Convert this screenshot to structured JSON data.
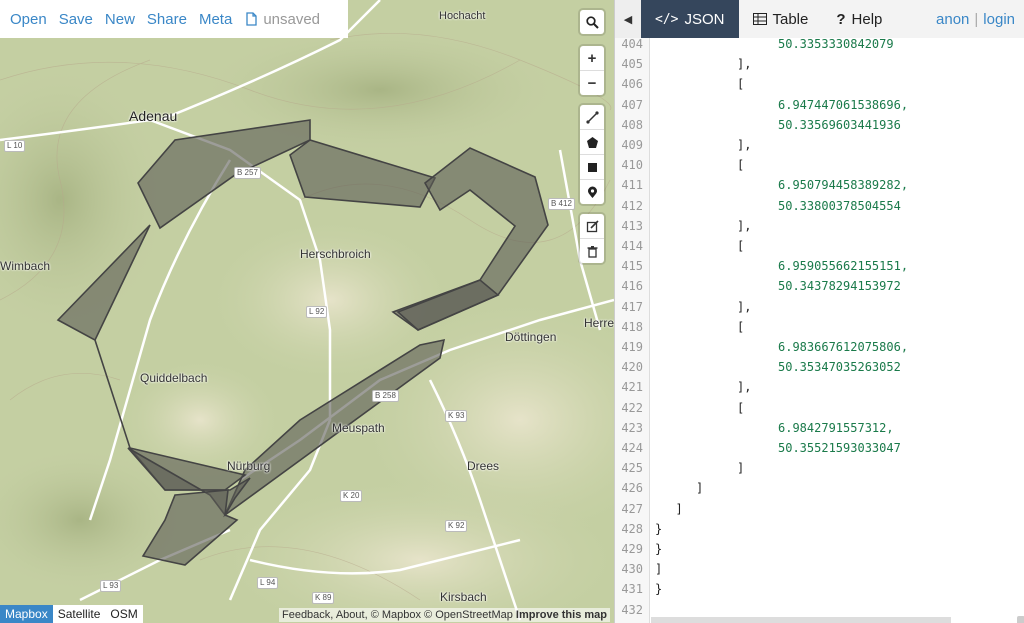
{
  "menu": {
    "items": [
      {
        "label": "Open"
      },
      {
        "label": "Save"
      },
      {
        "label": "New"
      },
      {
        "label": "Share"
      },
      {
        "label": "Meta"
      }
    ],
    "status": "unsaved"
  },
  "map": {
    "places": [
      {
        "name": "Adenau"
      },
      {
        "name": "Hochacht"
      },
      {
        "name": "Wimbach"
      },
      {
        "name": "Herschbroich"
      },
      {
        "name": "Quiddelbach"
      },
      {
        "name": "Nürburg"
      },
      {
        "name": "Meuspath"
      },
      {
        "name": "Döttingen"
      },
      {
        "name": "Drees"
      },
      {
        "name": "Kirsbach"
      },
      {
        "name": "Herre"
      }
    ],
    "roads": [
      {
        "label": "L 10"
      },
      {
        "label": "B 257"
      },
      {
        "label": "L 92"
      },
      {
        "label": "B 258"
      },
      {
        "label": "K 93"
      },
      {
        "label": "K 20"
      },
      {
        "label": "K 92"
      },
      {
        "label": "L 94"
      },
      {
        "label": "K 89"
      },
      {
        "label": "L 93"
      },
      {
        "label": "B 412"
      }
    ],
    "layers": [
      {
        "label": "Mapbox",
        "active": true
      },
      {
        "label": "Satellite",
        "active": false
      },
      {
        "label": "OSM",
        "active": false
      }
    ],
    "attribution": {
      "feedback": "Feedback",
      "about": "About",
      "copyright": "© Mapbox © OpenStreetMap",
      "improve": "Improve this map"
    }
  },
  "panel": {
    "tabs": [
      {
        "label": "JSON",
        "active": true
      },
      {
        "label": "Table",
        "active": false
      },
      {
        "label": "Help",
        "active": false
      }
    ],
    "auth": {
      "anon": "anon",
      "sep": "|",
      "login": "login"
    },
    "lines": [
      {
        "n": "404",
        "indent": "      ",
        "text": "50.3353330842079",
        "kind": "num"
      },
      {
        "n": "405",
        "indent": "    ",
        "text": "],",
        "kind": "punc"
      },
      {
        "n": "406",
        "indent": "    ",
        "text": "[",
        "kind": "punc"
      },
      {
        "n": "407",
        "indent": "      ",
        "text": "6.947447061538696,",
        "kind": "num"
      },
      {
        "n": "408",
        "indent": "      ",
        "text": "50.33569603441936",
        "kind": "num"
      },
      {
        "n": "409",
        "indent": "    ",
        "text": "],",
        "kind": "punc"
      },
      {
        "n": "410",
        "indent": "    ",
        "text": "[",
        "kind": "punc"
      },
      {
        "n": "411",
        "indent": "      ",
        "text": "6.950794458389282,",
        "kind": "num"
      },
      {
        "n": "412",
        "indent": "      ",
        "text": "50.33800378504554",
        "kind": "num"
      },
      {
        "n": "413",
        "indent": "    ",
        "text": "],",
        "kind": "punc"
      },
      {
        "n": "414",
        "indent": "    ",
        "text": "[",
        "kind": "punc"
      },
      {
        "n": "415",
        "indent": "      ",
        "text": "6.959055662155151,",
        "kind": "num"
      },
      {
        "n": "416",
        "indent": "      ",
        "text": "50.34378294153972",
        "kind": "num"
      },
      {
        "n": "417",
        "indent": "    ",
        "text": "],",
        "kind": "punc"
      },
      {
        "n": "418",
        "indent": "    ",
        "text": "[",
        "kind": "punc"
      },
      {
        "n": "419",
        "indent": "      ",
        "text": "6.983667612075806,",
        "kind": "num"
      },
      {
        "n": "420",
        "indent": "      ",
        "text": "50.35347035263052",
        "kind": "num"
      },
      {
        "n": "421",
        "indent": "    ",
        "text": "],",
        "kind": "punc"
      },
      {
        "n": "422",
        "indent": "    ",
        "text": "[",
        "kind": "punc"
      },
      {
        "n": "423",
        "indent": "      ",
        "text": "6.9842791557312,",
        "kind": "num"
      },
      {
        "n": "424",
        "indent": "      ",
        "text": "50.35521593033047",
        "kind": "num"
      },
      {
        "n": "425",
        "indent": "    ",
        "text": "]",
        "kind": "punc"
      },
      {
        "n": "426",
        "indent": "  ",
        "text": "]",
        "kind": "punc"
      },
      {
        "n": "427",
        "indent": " ",
        "text": "]",
        "kind": "punc"
      },
      {
        "n": "428",
        "indent": "",
        "text": "}",
        "kind": "punc"
      },
      {
        "n": "429",
        "indent": "",
        "text": "}",
        "kind": "punc"
      },
      {
        "n": "430",
        "indent": "",
        "text": "]",
        "kind": "punc"
      },
      {
        "n": "431",
        "indent": "",
        "text": "}",
        "kind": "punc"
      },
      {
        "n": "432",
        "indent": "",
        "text": "",
        "kind": "punc"
      }
    ]
  },
  "colors": {
    "accent": "#3a87c7",
    "tab_active": "#35465c",
    "number": "#1a7a4a",
    "polygon": "#5c5c55"
  }
}
